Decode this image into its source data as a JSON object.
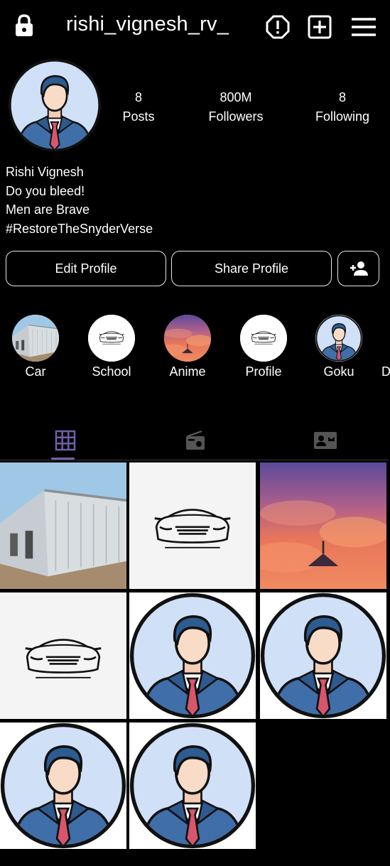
{
  "header": {
    "username": "rishi_vignesh_rv_",
    "icons": [
      "lock-icon",
      "alert-icon",
      "add-post-icon",
      "menu-icon"
    ]
  },
  "profile": {
    "stats": [
      {
        "value": "8",
        "label": "Posts"
      },
      {
        "value": "800M",
        "label": "Followers"
      },
      {
        "value": "8",
        "label": "Following"
      }
    ],
    "bio": [
      "Rishi Vignesh",
      "Do you bleed!",
      "Men are Brave",
      "#RestoreTheSnyderVerse"
    ]
  },
  "buttons": {
    "edit": "Edit Profile",
    "share": "Share Profile"
  },
  "highlights": [
    {
      "label": "Car"
    },
    {
      "label": "School"
    },
    {
      "label": "Anime"
    },
    {
      "label": "Profile"
    },
    {
      "label": "Goku"
    },
    {
      "label": "D"
    }
  ],
  "tabs": [
    "grid-icon",
    "reels-icon",
    "tagged-icon"
  ],
  "colors": {
    "background": "#000000",
    "accent": "#6f5fa8",
    "text": "#ffffff"
  }
}
